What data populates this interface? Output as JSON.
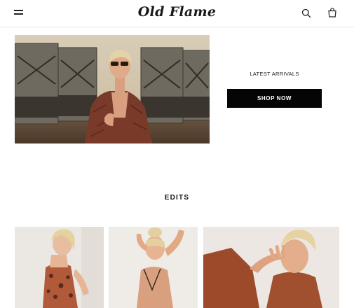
{
  "header": {
    "logo_text": "Old Flame",
    "icons": [
      "menu-icon",
      "search-icon",
      "bag-icon"
    ]
  },
  "hero": {
    "label": "LATEST ARRIVALS",
    "button_label": "SHOP NOW"
  },
  "edits": {
    "title": "EDITS"
  },
  "colors": {
    "button_bg": "#050505",
    "text": "#111111",
    "background": "#ffffff"
  }
}
